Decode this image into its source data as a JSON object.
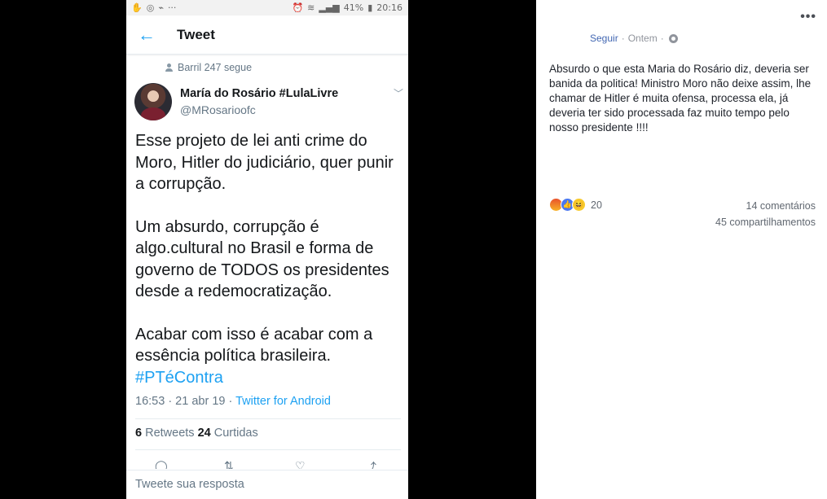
{
  "status_bar": {
    "battery": "41%",
    "time": "20:16"
  },
  "twitter": {
    "header_title": "Tweet",
    "retweet_note": "Barril 247 segue",
    "author": {
      "name": "María do Rosário #LulaLivre",
      "handle": "@MRosarioofc"
    },
    "tweet": {
      "paragraph1": "Esse projeto de lei anti crime do Moro, Hitler do judiciário, quer punir a corrupção.",
      "paragraph2": "Um absurdo, corrupção é algo.cultural no Brasil e forma de governo de TODOS os presidentes desde a redemocratização.",
      "paragraph3": "Acabar com isso é acabar com a essência política brasileira.",
      "hashtag": "#PTéContra"
    },
    "meta": {
      "datetime": "16:53 · 21 abr 19 · ",
      "source": "Twitter for Android"
    },
    "stats": {
      "retweets_count": "6",
      "retweets_label": " Retweets ",
      "likes_count": "24",
      "likes_label": " Curtidas"
    },
    "reply_placeholder": "Tweete sua resposta"
  },
  "facebook": {
    "more_icon": "more-options-icon",
    "follow_label": "Seguir",
    "separator": "·",
    "time": "Ontem",
    "privacy_icon": "globe-icon",
    "post_text": "Absurdo o que esta Maria do Rosário diz, deveria ser banida da politica! Ministro Moro não deixe assim, lhe chamar de Hitler é muita ofensa, processa ela, já deveria ter sido processada faz muito tempo pelo nosso presidente !!!!",
    "reaction_count": "20",
    "comments": "14 comentários",
    "shares": "45 compartilhamentos"
  }
}
